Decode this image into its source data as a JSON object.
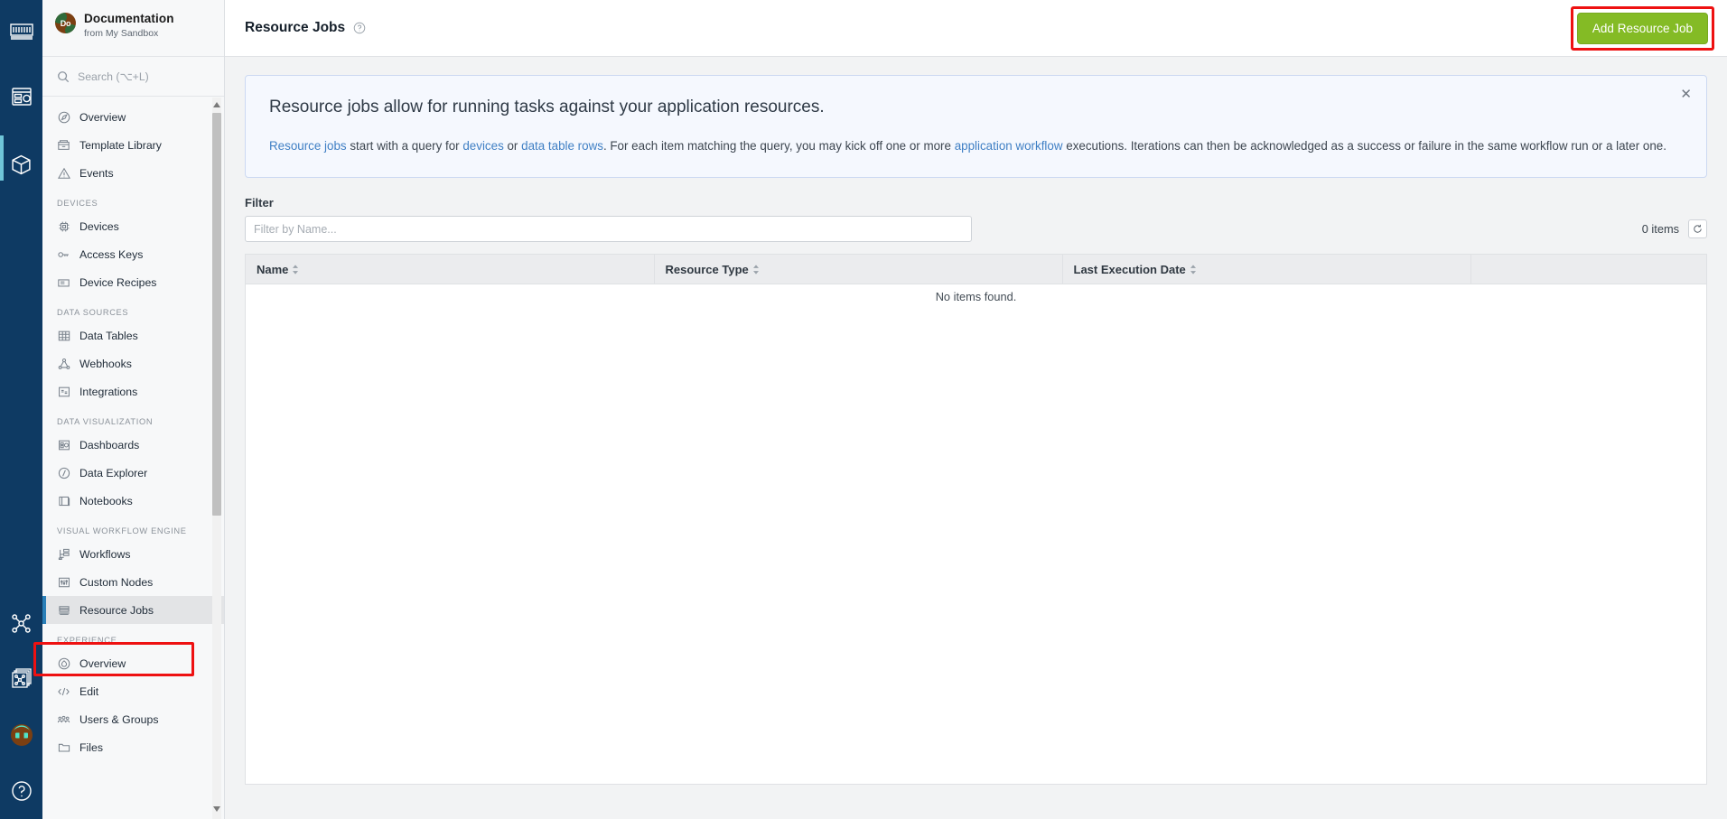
{
  "colors": {
    "rail_bg": "#0e3a63",
    "sidebar_bg": "#f7f8f9",
    "accent_blue": "#2a7fb8",
    "add_button_green": "#84bb25",
    "highlight_red": "#ee1111",
    "banner_bg": "#f5f8fe",
    "link_blue": "#3f7fc4"
  },
  "icon_rail": {
    "items": [
      {
        "name": "weg-logo-icon",
        "label": "WEG"
      },
      {
        "name": "dashboard-rail-icon",
        "label": "Dashboards"
      },
      {
        "name": "cube-rail-icon",
        "label": "Applications",
        "active": true
      },
      {
        "name": "nodes-rail-icon",
        "label": "Workflows"
      },
      {
        "name": "stacked-nodes-rail-icon",
        "label": "Edge Workflows"
      },
      {
        "name": "avatar-rail-icon",
        "label": "Account"
      },
      {
        "name": "help-rail-icon",
        "label": "Help"
      }
    ]
  },
  "sidebar": {
    "app": {
      "avatar_initials": "Do",
      "title": "Documentation",
      "subtitle": "from My Sandbox"
    },
    "search": {
      "placeholder": "Search (⌥+L)",
      "icon": "search-icon"
    },
    "groups": [
      {
        "section": "",
        "items": [
          {
            "label": "Overview",
            "icon": "overview-icon"
          },
          {
            "label": "Template Library",
            "icon": "template-library-icon"
          },
          {
            "label": "Events",
            "icon": "events-warning-icon"
          }
        ]
      },
      {
        "section": "DEVICES",
        "items": [
          {
            "label": "Devices",
            "icon": "device-chip-icon"
          },
          {
            "label": "Access Keys",
            "icon": "access-keys-icon"
          },
          {
            "label": "Device Recipes",
            "icon": "device-recipes-icon"
          }
        ]
      },
      {
        "section": "DATA SOURCES",
        "items": [
          {
            "label": "Data Tables",
            "icon": "data-tables-grid-icon"
          },
          {
            "label": "Webhooks",
            "icon": "webhooks-icon"
          },
          {
            "label": "Integrations",
            "icon": "integrations-icon"
          }
        ]
      },
      {
        "section": "DATA VISUALIZATION",
        "items": [
          {
            "label": "Dashboards",
            "icon": "dashboards-icon"
          },
          {
            "label": "Data Explorer",
            "icon": "data-explorer-compass-icon"
          },
          {
            "label": "Notebooks",
            "icon": "notebooks-icon"
          }
        ]
      },
      {
        "section": "VISUAL WORKFLOW ENGINE",
        "items": [
          {
            "label": "Workflows",
            "icon": "workflows-icon"
          },
          {
            "label": "Custom Nodes",
            "icon": "custom-nodes-icon"
          },
          {
            "label": "Resource Jobs",
            "icon": "resource-jobs-icon",
            "selected": true
          }
        ]
      },
      {
        "section": "EXPERIENCE",
        "items": [
          {
            "label": "Overview",
            "icon": "experience-overview-icon"
          },
          {
            "label": "Edit",
            "icon": "edit-code-icon"
          },
          {
            "label": "Users & Groups",
            "icon": "users-groups-icon"
          },
          {
            "label": "Files",
            "icon": "files-folder-icon"
          }
        ]
      }
    ]
  },
  "topbar": {
    "page_title": "Resource Jobs",
    "help_icon": "help-circle-icon",
    "add_button_label": "Add Resource Job"
  },
  "banner": {
    "close_icon": "close-icon",
    "heading": "Resource jobs allow for running tasks against your application resources.",
    "body": {
      "link1": "Resource jobs",
      "text1": " start with a query for ",
      "link2": "devices",
      "text2": " or ",
      "link3": "data table rows",
      "text3": ". For each item matching the query, you may kick off one or more ",
      "link4": "application workflow",
      "text4": " executions. Iterations can then be acknowledged as a success or failure in the same workflow run or a later one."
    }
  },
  "filter": {
    "label": "Filter",
    "placeholder": "Filter by Name...",
    "value": "",
    "item_count": "0 items",
    "refresh_icon": "refresh-icon"
  },
  "table": {
    "columns": [
      {
        "label": "Name",
        "sortable": true
      },
      {
        "label": "Resource Type",
        "sortable": true
      },
      {
        "label": "Last Execution Date",
        "sortable": true
      },
      {
        "label": "",
        "sortable": false
      }
    ],
    "rows": [],
    "empty_message": "No items found."
  },
  "annotations": {
    "sidebar_highlight": "Resource Jobs",
    "button_highlight": "Add Resource Job"
  }
}
